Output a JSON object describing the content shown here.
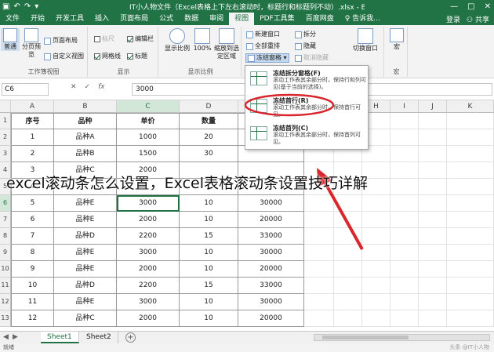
{
  "titlebar": {
    "title": "IT小人物文件（Excel表格上下左右滚动时，标题行和标题列不动）.xlsx - Excel",
    "minimize": "—",
    "maximize": "□",
    "close": "✕"
  },
  "tabs": [
    "文件",
    "开始",
    "开发工具",
    "插入",
    "页面布局",
    "公式",
    "数据",
    "审阅",
    "视图",
    "PDF工具集",
    "百度网盘"
  ],
  "active_tab_index": 8,
  "tell_me": "♀ 告诉我...",
  "account": {
    "login": "登录",
    "share": "共享"
  },
  "ribbon": {
    "views": {
      "normal": "普通",
      "page_break": "分页预览",
      "page_layout": "页面布局",
      "custom_views": "自定义视图",
      "label": "工作簿视图"
    },
    "show": {
      "ruler": "标尺",
      "gridlines": "网格线",
      "formula_bar": "编辑栏",
      "headings": "标题",
      "label": "显示"
    },
    "zoom": {
      "zoom": "显示比例",
      "zoom_100": "100%",
      "zoom_selection": "缩放到选定区域",
      "label": "显示比例"
    },
    "window": {
      "new_window": "新建窗口",
      "arrange_all": "全部重排",
      "freeze_panes": "冻结窗格 ▾",
      "split": "拆分",
      "hide": "隐藏",
      "unhide": "取消隐藏",
      "switch_windows": "切换窗口",
      "label": "窗口"
    },
    "macros": {
      "macros": "宏",
      "label": "宏"
    }
  },
  "formula_bar": {
    "name_box": "C6",
    "cancel": "✕",
    "enter": "✓",
    "fx": "fx",
    "value": "3000"
  },
  "columns": [
    "A",
    "B",
    "C",
    "D",
    "E",
    "F",
    "G",
    "H",
    "I",
    "J",
    "K"
  ],
  "rows": [
    "1",
    "2",
    "3",
    "4",
    "5",
    "6",
    "7",
    "8",
    "9",
    "10",
    "11",
    "12",
    "13"
  ],
  "table": {
    "headers": [
      "序号",
      "品种",
      "单价",
      "数量",
      ""
    ],
    "rows": [
      [
        "1",
        "品种A",
        "1000",
        "20",
        ""
      ],
      [
        "2",
        "品种B",
        "1500",
        "30",
        ""
      ],
      [
        "3",
        "品种C",
        "2000",
        "",
        ""
      ],
      [
        "4",
        "",
        "",
        "",
        ""
      ],
      [
        "5",
        "品种E",
        "3000",
        "10",
        "30000"
      ],
      [
        "6",
        "品种E",
        "2000",
        "10",
        "20000"
      ],
      [
        "7",
        "品种D",
        "2200",
        "15",
        "33000"
      ],
      [
        "8",
        "品种E",
        "3000",
        "10",
        "30000"
      ],
      [
        "9",
        "品种E",
        "2000",
        "10",
        "20000"
      ],
      [
        "10",
        "品种D",
        "2200",
        "15",
        "33000"
      ],
      [
        "11",
        "品种E",
        "3000",
        "10",
        "30000"
      ],
      [
        "12",
        "品种C",
        "2000",
        "10",
        "20000"
      ],
      [
        "13",
        "品种D",
        "2200",
        "15",
        "33000"
      ]
    ]
  },
  "freeze_menu": [
    {
      "title": "冻结拆分窗格(F)",
      "desc": "滚动工作表其余部分时，保持行和列可见(基于当前的选择)。"
    },
    {
      "title": "冻结首行(R)",
      "desc": "滚动工作表其余部分时，保持首行可见。"
    },
    {
      "title": "冻结首列(C)",
      "desc": "滚动工作表其余部分时，保持首列可见。"
    }
  ],
  "overlay_caption": "excel滚动条怎么设置，Excel表格滚动条设置技巧详解",
  "sheets": [
    "Sheet1",
    "Sheet2"
  ],
  "active_sheet_index": 0,
  "add_sheet": "+",
  "status": "就绪",
  "watermark": "头条 @IT小人物",
  "colors": {
    "excel_green": "#217346",
    "annotation_red": "#d9262c"
  }
}
